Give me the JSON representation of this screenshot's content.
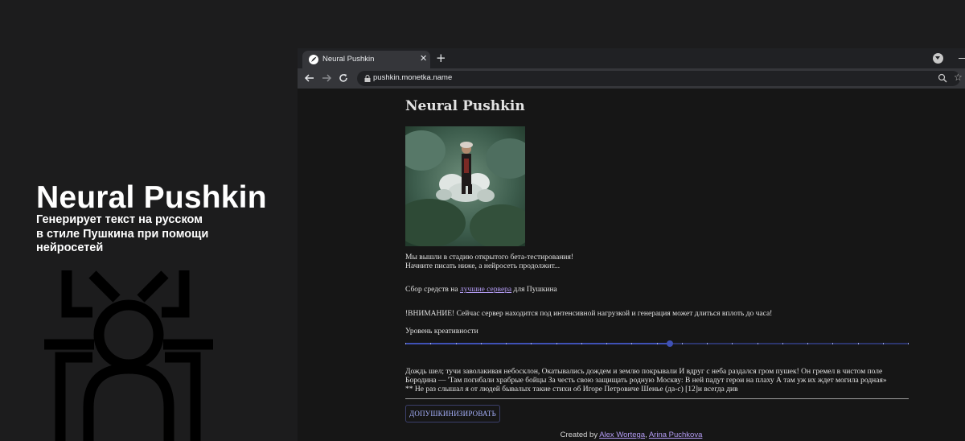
{
  "promo": {
    "title": "Neural Pushkin",
    "subtitle_lines": [
      "Генерирует текст на русском",
      "в стиле Пушкина при помощи",
      "нейросетей"
    ]
  },
  "browser": {
    "tab": {
      "title": "Neural Pushkin",
      "close": "✕"
    },
    "new_tab": "+",
    "url": "pushkin.monetka.name",
    "nav": {
      "back": "←",
      "forward": "→",
      "reload": "↻"
    },
    "star": "☆"
  },
  "page": {
    "title": "Neural Pushkin",
    "intro_line1": "Мы вышли в стадию открытого бета-тестирования!",
    "intro_line2": "Начните писать ниже, а нейросеть продолжит...",
    "fund_prefix": "Сбор средств на ",
    "fund_link": "лучшие сервера",
    "fund_suffix": " для Пушкина",
    "warning": "!ВНИМАНИЕ! Сейчас сервер находится под интенсивной нагрузкой и генерация может длиться вплоть до часа!",
    "creativity_label": "Уровень креативности",
    "creativity_level": 0.525,
    "creativity_steps": 20,
    "poem_lines": [
      "Дождь шел; тучи заволакивая небосклон, Окатывались дождем и землю покрывали  И вдруг с неба раздался гром пушек! Он гремел в чистом поле",
      "Бородина — 'Там погибали храбрые бойцы За честь свою защищать родную Москву: В ней падут герои на плаху    А там уж их ждет могила родная»",
      " ** Не раз слышал я от людей бывалых такие стихи об Игоре Петровиче Шенье (да-с) [12]и всегда див"
    ],
    "button_label": "ДОПУШКИНИЗИРОВАТЬ",
    "footer_prefix": "Created by ",
    "footer_author1": "Alex Wortega",
    "footer_sep": ", ",
    "footer_author2": "Arina Puchkova"
  },
  "colors": {
    "background": "#1c1c1d",
    "page_bg": "#161616",
    "link": "#b49cf5",
    "slider_accent": "#3f51b5",
    "button_text": "#a8b3ff"
  },
  "icons": [
    "quill-favicon-icon",
    "lock-icon",
    "zoom-icon",
    "star-icon",
    "tab-search-icon",
    "bug-logo-icon"
  ]
}
